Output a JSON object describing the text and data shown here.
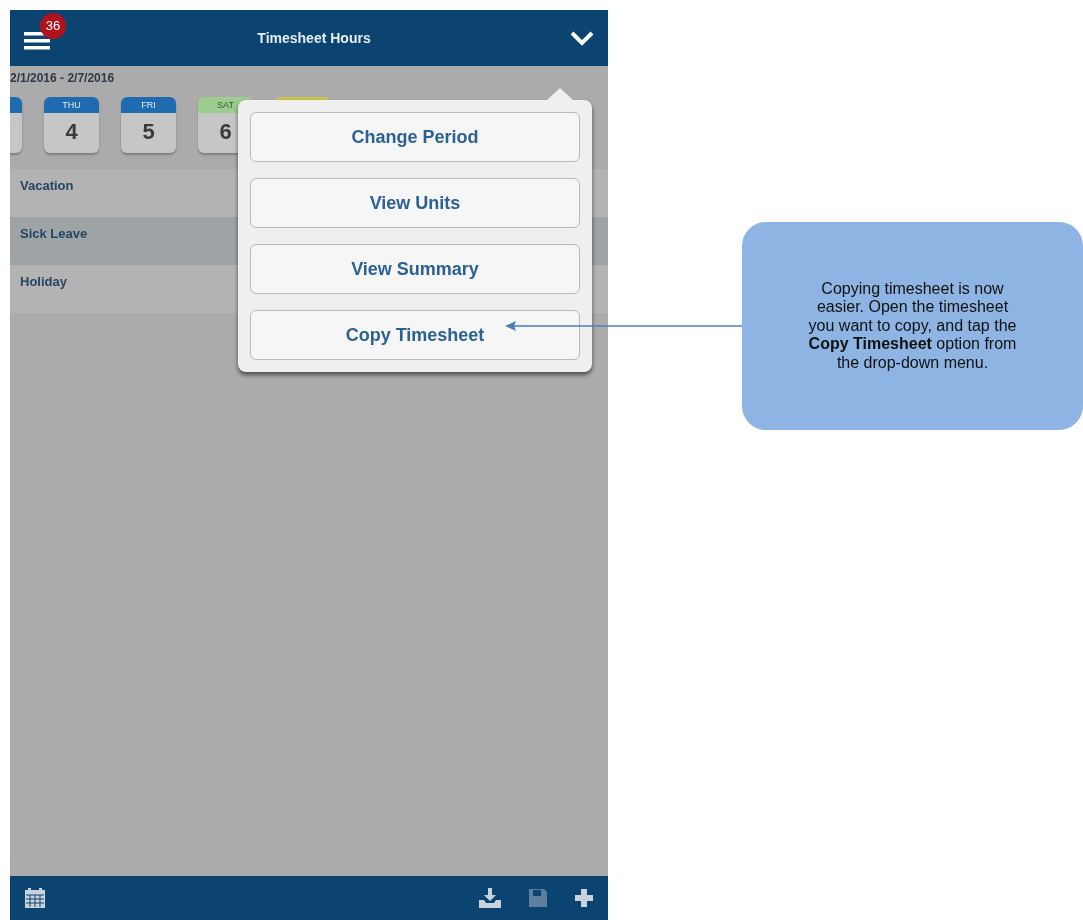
{
  "header": {
    "title": "Timesheet Hours",
    "badge": "36"
  },
  "period": "2/1/2016 - 2/7/2016",
  "days": [
    {
      "kind": "partial",
      "color": "#1e6bb0"
    },
    {
      "kind": "day",
      "day": "THU",
      "date": "4",
      "color": "#1e6bb0"
    },
    {
      "kind": "day",
      "day": "FRI",
      "date": "5",
      "color": "#1e6bb0"
    },
    {
      "kind": "day",
      "day": "SAT",
      "date": "6",
      "color": "#9ccc8e"
    },
    {
      "kind": "partial",
      "color": "#c9c44a"
    }
  ],
  "pay_codes": [
    {
      "label": "Vacation",
      "selected": false
    },
    {
      "label": "Sick Leave",
      "selected": true
    },
    {
      "label": "Holiday",
      "selected": false
    }
  ],
  "menu": {
    "items": [
      "Change Period",
      "View Units",
      "View Summary",
      "Copy Timesheet"
    ]
  },
  "callout": {
    "text": "Copying timesheet is now easier. Open the timesheet you want to copy, and tap the **Copy Timesheet** option from the drop-down menu."
  },
  "toolbar": [
    {
      "kind": "calendar",
      "disabled": false
    },
    {
      "kind": "download",
      "disabled": false
    },
    {
      "kind": "save",
      "disabled": true
    },
    {
      "kind": "add",
      "disabled": false
    }
  ]
}
